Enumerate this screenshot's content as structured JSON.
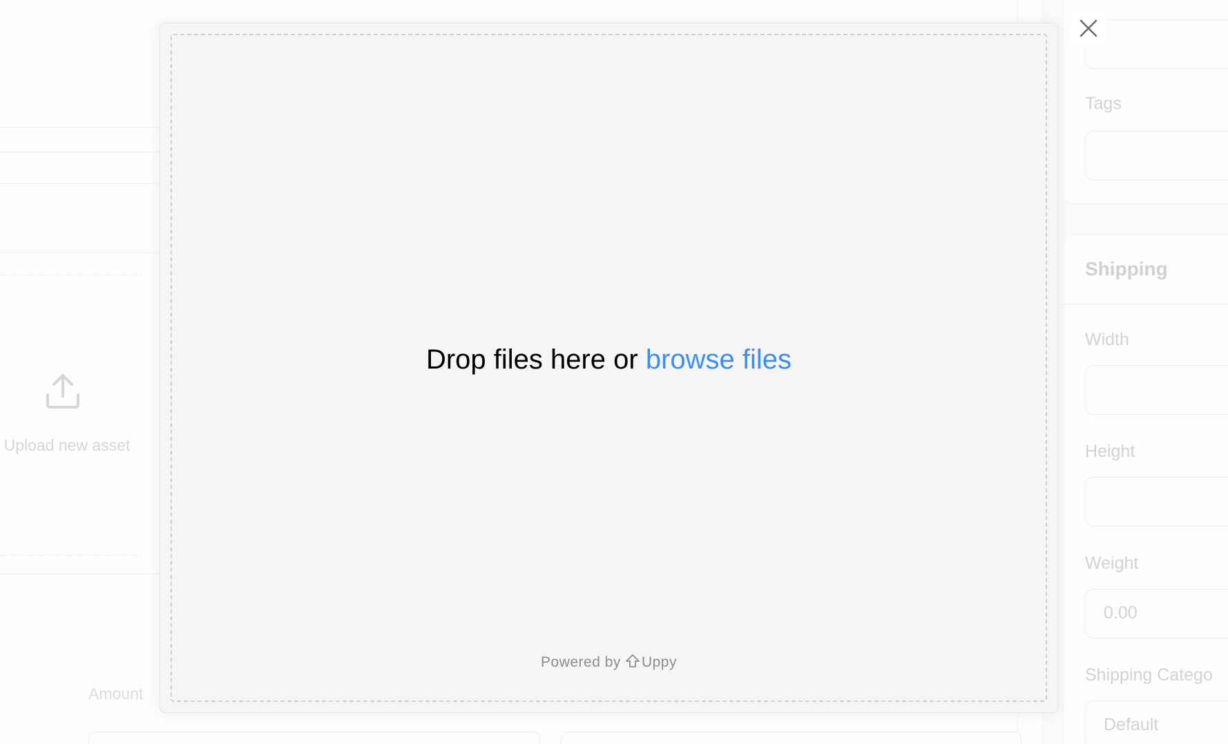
{
  "modal": {
    "drop_text": "Drop files here or",
    "browse_link": "browse files",
    "powered_by": "Powered by",
    "brand": "Uppy",
    "brand_icon": "uppy-arrow-icon",
    "close_icon": "close-icon",
    "link_color": "#3b8ff1"
  },
  "background": {
    "upload_label": "Upload new asset",
    "upload_icon": "upload-icon",
    "amount_label": "Amount",
    "right_panel": {
      "tags_label": "Tags",
      "shipping_title": "Shipping",
      "width_label": "Width",
      "height_label": "Height",
      "weight_label": "Weight",
      "weight_value": "0.00",
      "shipping_category_label": "Shipping Catego",
      "shipping_category_value": "Default"
    }
  }
}
